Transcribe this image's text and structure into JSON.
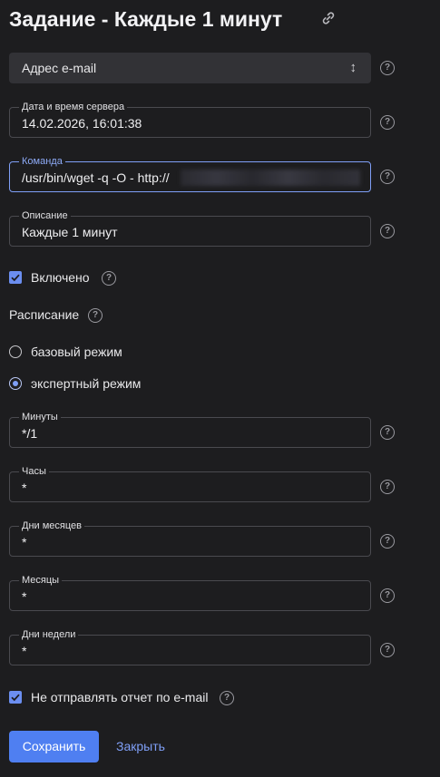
{
  "header": {
    "title": "Задание - Каждые 1 минут"
  },
  "form": {
    "mail_select": {
      "value": "Адрес e-mail"
    },
    "server_time": {
      "label": "Дата и время сервера",
      "value": "14.02.2026, 16:01:38"
    },
    "command": {
      "label": "Команда",
      "value": "/usr/bin/wget -q -O - http://"
    },
    "description": {
      "label": "Описание",
      "value": "Каждые 1 минут"
    },
    "enabled": {
      "label": "Включено",
      "checked": true
    },
    "schedule": {
      "title": "Расписание",
      "mode_basic": "базовый режим",
      "mode_expert": "экспертный режим",
      "selected_mode": "expert"
    },
    "minutes": {
      "label": "Минуты",
      "value": "*/1"
    },
    "hours": {
      "label": "Часы",
      "value": "*"
    },
    "month_days": {
      "label": "Дни месяцев",
      "value": "*"
    },
    "months": {
      "label": "Месяцы",
      "value": "*"
    },
    "weekdays": {
      "label": "Дни недели",
      "value": "*"
    },
    "no_report": {
      "label": "Не отправлять отчет по e-mail",
      "checked": true
    }
  },
  "actions": {
    "save": "Сохранить",
    "close": "Закрыть"
  },
  "icons": {
    "help": "?",
    "select_arrows": "↕"
  },
  "colors": {
    "accent": "#4f7ff1",
    "link": "#7f9ff6",
    "background": "#1d1d1f"
  }
}
